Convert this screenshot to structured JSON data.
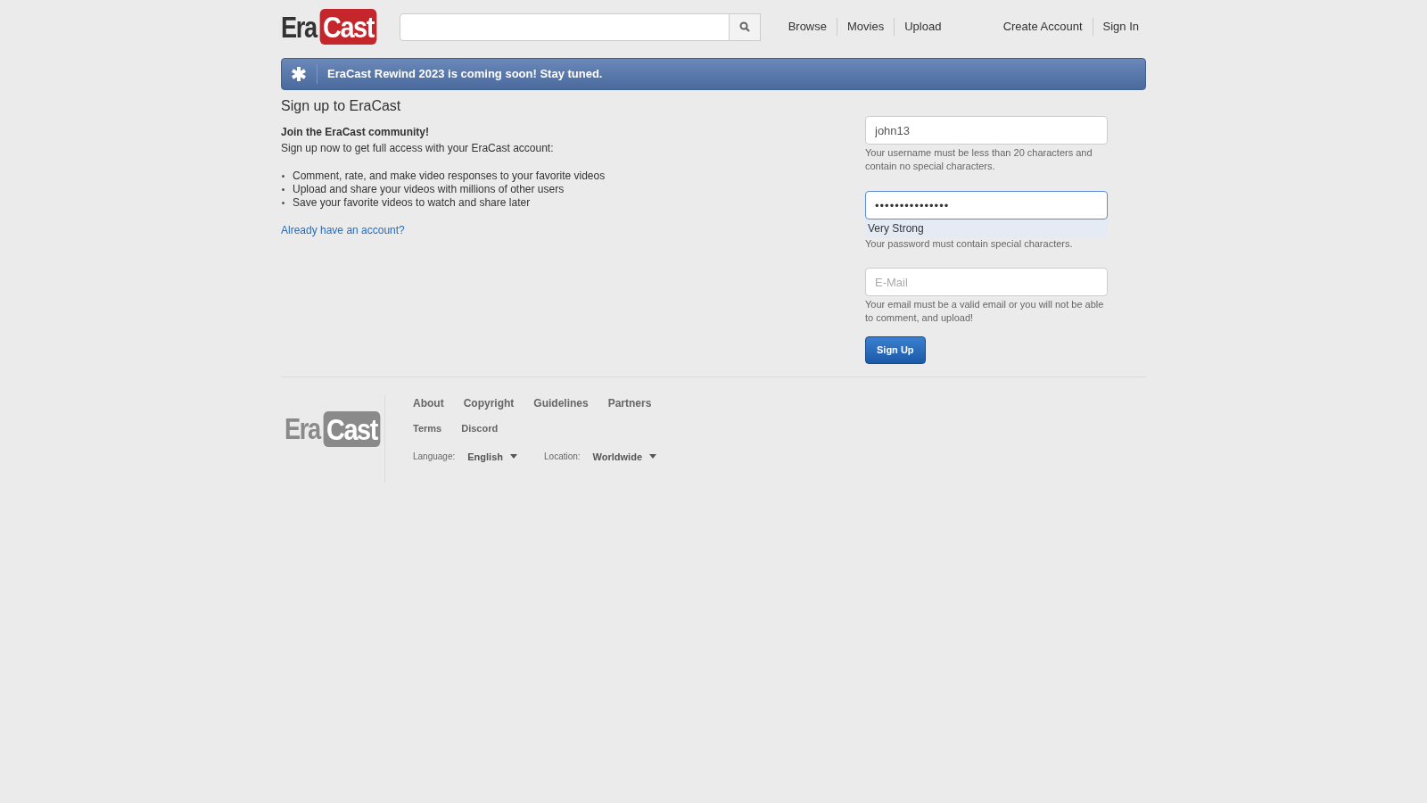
{
  "header": {
    "logo": {
      "part_1": "Era",
      "part_2": "Cast"
    },
    "nav": [
      "Browse",
      "Movies",
      "Upload"
    ],
    "account_links": [
      "Create Account",
      "Sign In"
    ]
  },
  "banner": {
    "text": "EraCast Rewind 2023 is coming soon! Stay tuned."
  },
  "page_title": "Sign up to EraCast",
  "intro": {
    "heading": "Join the EraCast community!",
    "text": "Sign up now to get full access with your EraCast account:",
    "bullets": [
      "Comment, rate, and make video responses to your favorite videos",
      "Upload and share your videos with millions of other users",
      "Save your favorite videos to watch and share later"
    ],
    "link": "Already have an account?"
  },
  "form": {
    "username": {
      "value": "john13",
      "hint": "Your username must be less than 20 characters and contain no special characters."
    },
    "password": {
      "value": "•••••••••••••••",
      "strength": "Very Strong",
      "hint": "Your password must contain special characters."
    },
    "email": {
      "placeholder": "E-Mail",
      "hint": "Your email must be a valid email or you will not be able to comment, and upload!"
    },
    "submit": "Sign Up"
  },
  "footer": {
    "logo": {
      "part_1": "Era",
      "part_2": "Cast"
    },
    "links": [
      "About",
      "Copyright",
      "Guidelines",
      "Partners"
    ],
    "links_2": [
      "Terms",
      "Discord"
    ],
    "language": {
      "label": "Language:",
      "value": "English"
    },
    "location": {
      "label": "Location:",
      "value": "Worldwide"
    }
  }
}
